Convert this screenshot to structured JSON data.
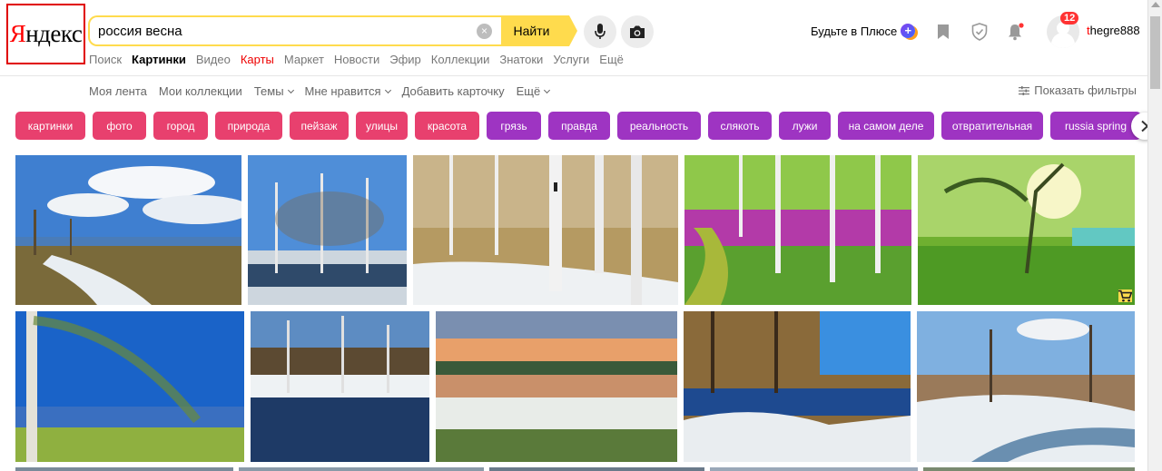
{
  "logo": {
    "first": "Я",
    "rest": "ндекс"
  },
  "search": {
    "value": "россия весна",
    "placeholder": "",
    "button_label": "Найти"
  },
  "plus": {
    "label": "Будьте в Плюсе",
    "badge": "+"
  },
  "user": {
    "first": "t",
    "rest": "hegre888",
    "notifications": "12"
  },
  "tabs": [
    {
      "label": "Поиск"
    },
    {
      "label": "Картинки"
    },
    {
      "label": "Видео"
    },
    {
      "label": "Карты"
    },
    {
      "label": "Маркет"
    },
    {
      "label": "Новости"
    },
    {
      "label": "Эфир"
    },
    {
      "label": "Коллекции"
    },
    {
      "label": "Знатоки"
    },
    {
      "label": "Услуги"
    },
    {
      "label": "Ещё"
    }
  ],
  "subnav": {
    "feed": "Моя лента",
    "collections": "Мои коллекции",
    "topics": "Темы",
    "liked": "Мне нравится",
    "add_card": "Добавить карточку",
    "more": "Ещё",
    "show_filters": "Показать фильтры"
  },
  "colors": {
    "accent": "#ffdb4d",
    "chip_pink": "#e8406e",
    "chip_purple": "#9e34c2",
    "brand_red": "#ff0000"
  },
  "chips": [
    {
      "label": "картинки",
      "color": "#e8406e"
    },
    {
      "label": "фото",
      "color": "#e8406e"
    },
    {
      "label": "город",
      "color": "#e8406e"
    },
    {
      "label": "природа",
      "color": "#e8406e"
    },
    {
      "label": "пейзаж",
      "color": "#e8406e"
    },
    {
      "label": "улицы",
      "color": "#e8406e"
    },
    {
      "label": "красота",
      "color": "#e8406e"
    },
    {
      "label": "грязь",
      "color": "#9e34c2"
    },
    {
      "label": "правда",
      "color": "#9e34c2"
    },
    {
      "label": "реальность",
      "color": "#9e34c2"
    },
    {
      "label": "слякоть",
      "color": "#9e34c2"
    },
    {
      "label": "лужи",
      "color": "#9e34c2"
    },
    {
      "label": "на самом деле",
      "color": "#9e34c2"
    },
    {
      "label": "отвратительная",
      "color": "#9e34c2"
    },
    {
      "label": "russia spring",
      "color": "#9e34c2"
    }
  ],
  "icons": {
    "clear": "clear-icon",
    "mic": "microphone-icon",
    "camera": "camera-icon",
    "bookmark": "bookmark-icon",
    "shield": "shield-icon",
    "bell": "bell-icon",
    "filters": "filters-icon",
    "next": "chevron-right-icon",
    "cart": "cart-icon"
  }
}
